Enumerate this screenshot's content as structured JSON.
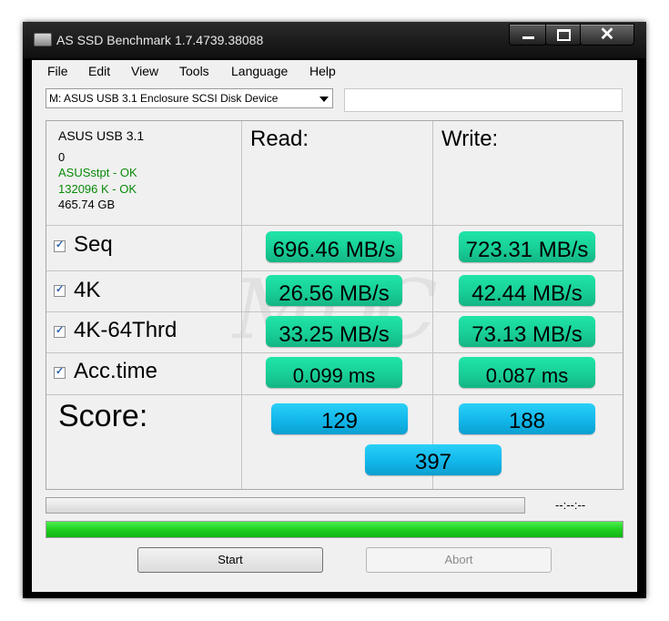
{
  "window": {
    "title": "AS SSD Benchmark 1.7.4739.38088"
  },
  "menu": [
    "File",
    "Edit",
    "View",
    "Tools",
    "Language",
    "Help"
  ],
  "drive": {
    "selected": "M: ASUS USB 3.1 Enclosure SCSI Disk Device",
    "extra_value": ""
  },
  "device_info": {
    "model": "ASUS USB 3.1",
    "firmware": "0",
    "driver": "ASUSstpt - OK",
    "alignment": "132096 K - OK",
    "size": "465.74 GB"
  },
  "headers": {
    "read": "Read:",
    "write": "Write:"
  },
  "tests": [
    {
      "label": "Seq",
      "checked": true,
      "read": "696.46 MB/s",
      "write": "723.31 MB/s"
    },
    {
      "label": "4K",
      "checked": true,
      "read": "26.56 MB/s",
      "write": "42.44 MB/s"
    },
    {
      "label": "4K-64Thrd",
      "checked": true,
      "read": "33.25 MB/s",
      "write": "73.13 MB/s"
    },
    {
      "label": "Acc.time",
      "checked": true,
      "read": "0.099 ms",
      "write": "0.087 ms"
    }
  ],
  "score": {
    "label": "Score:",
    "read": "129",
    "write": "188",
    "total": "397"
  },
  "status": {
    "timer": "--:--:--",
    "progress_percent": 100
  },
  "buttons": {
    "start": "Start",
    "abort": "Abort"
  },
  "colors": {
    "value_box": "#18cf97",
    "score_box": "#12b7ea",
    "progress": "#1fcf1f"
  }
}
